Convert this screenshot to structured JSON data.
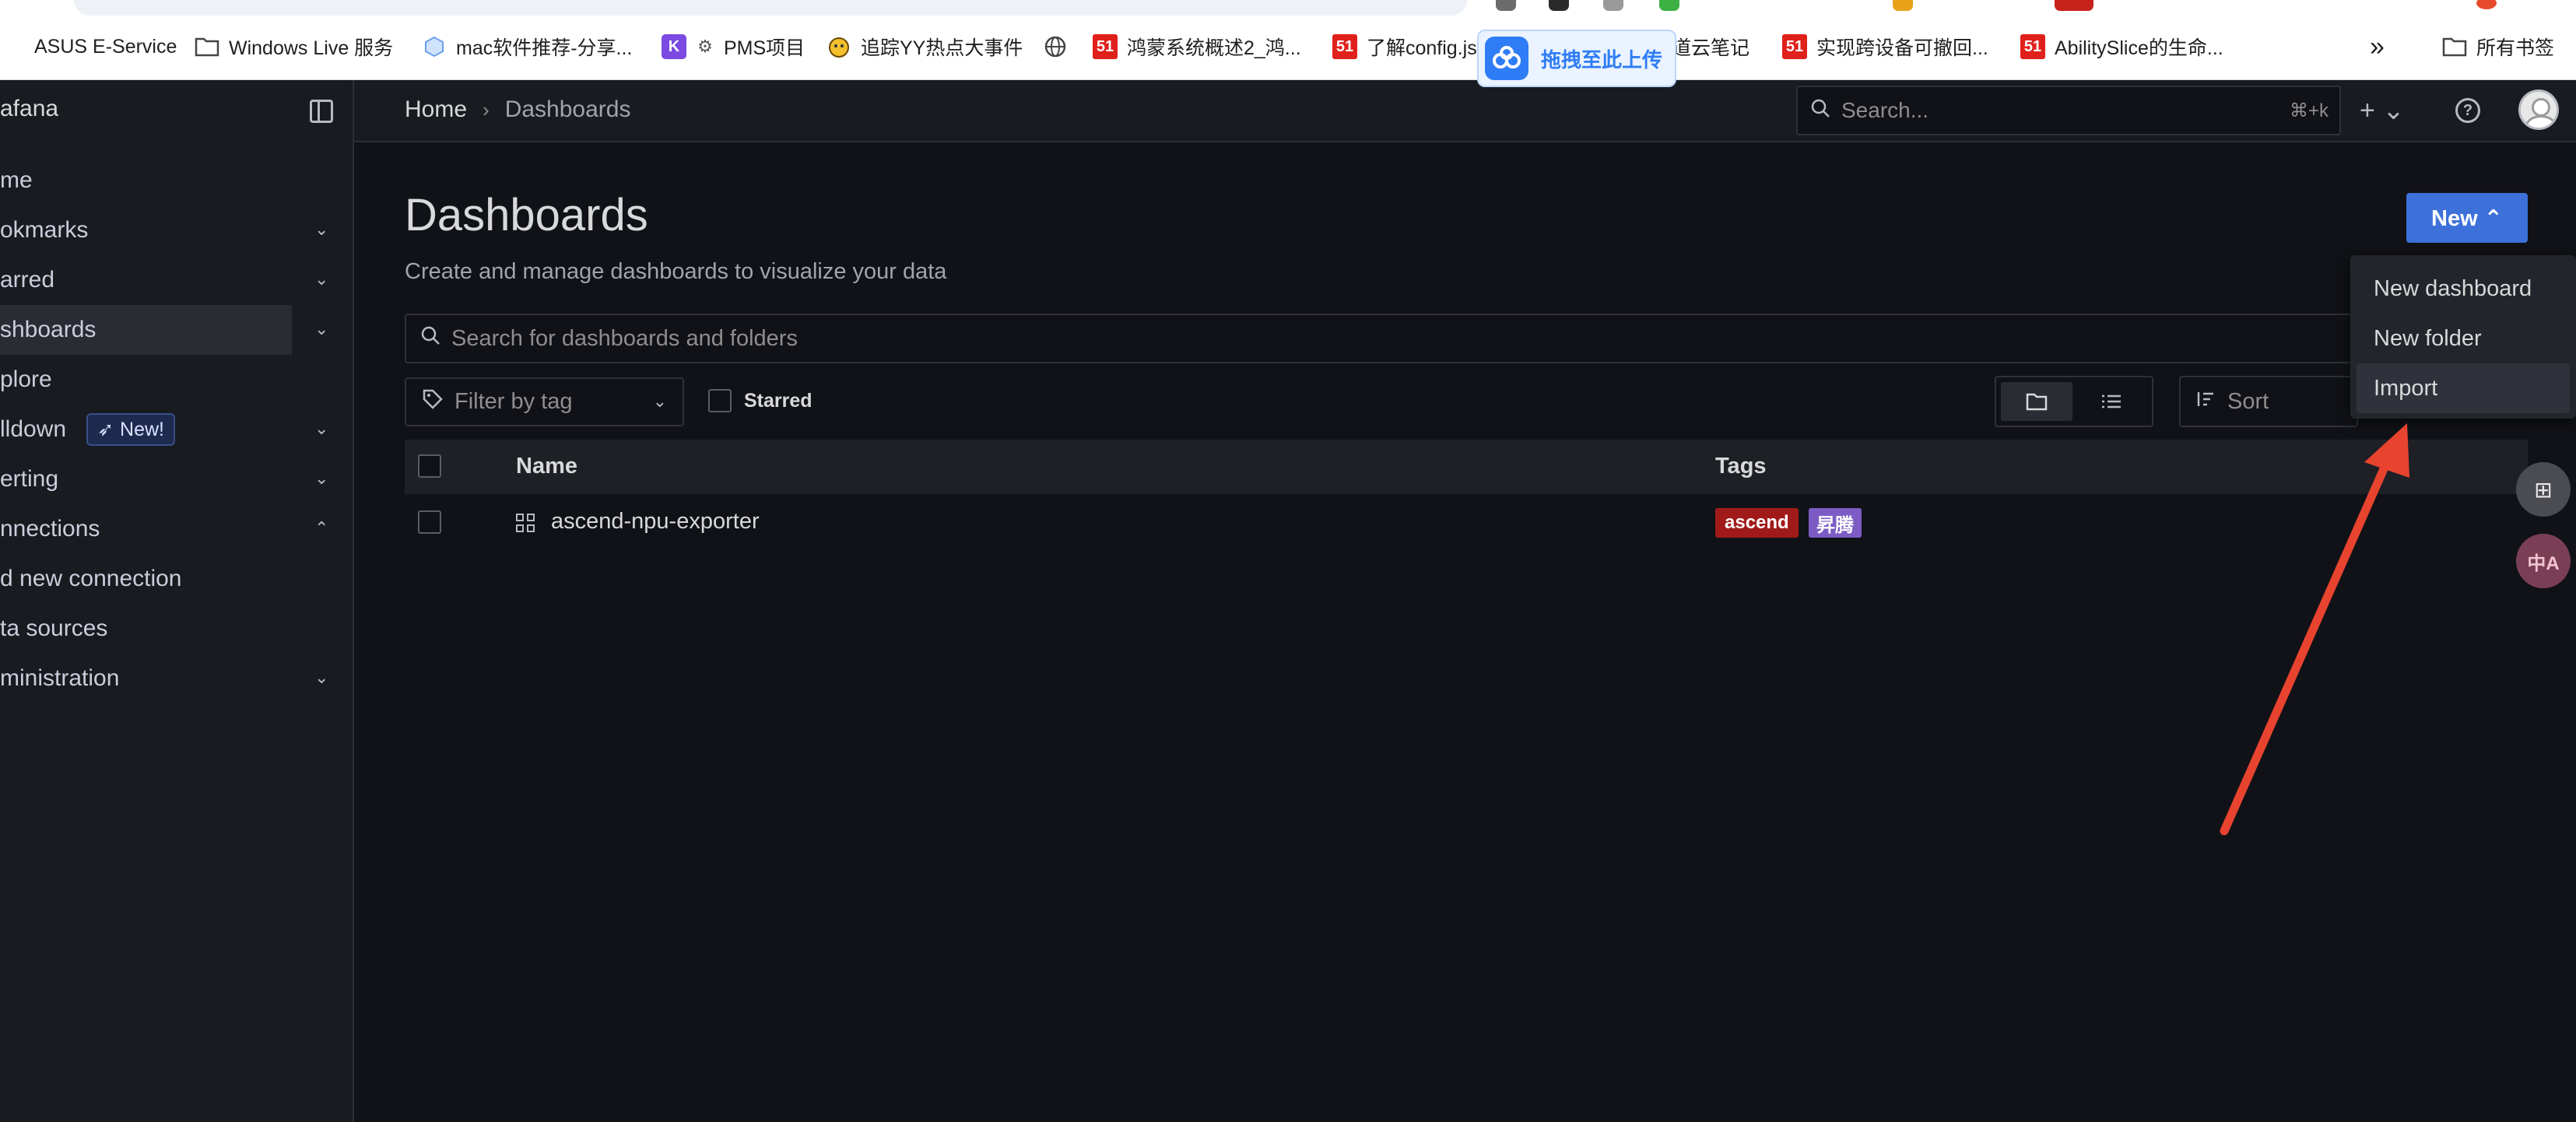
{
  "browser": {
    "bookmarks": [
      {
        "label": "ASUS E-Service",
        "icon": "asus-icon"
      },
      {
        "label": "Windows Live 服务",
        "icon": "folder-icon"
      },
      {
        "label": "mac软件推荐-分享...",
        "icon": "cube-icon"
      },
      {
        "label": "PMS项目",
        "icon": "k-icon"
      },
      {
        "label": "追踪YY热点大事件",
        "icon": "face-icon"
      },
      {
        "label": "",
        "icon": "globe-icon"
      },
      {
        "label": "鸿蒙系统概述2_鸿...",
        "icon": "51cto-icon"
      },
      {
        "label": "了解config.js",
        "icon": "51cto-icon"
      },
      {
        "label": "道云笔记",
        "icon": "note-icon"
      },
      {
        "label": "实现跨设备可撤回...",
        "icon": "51cto-icon"
      },
      {
        "label": "AbilitySlice的生命...",
        "icon": "51cto-icon"
      }
    ],
    "more_label": "»",
    "all_bookmarks_label": "所有书签",
    "upload_label": "拖拽至此上传",
    "icon_51": "51"
  },
  "app": {
    "brand": "afana",
    "search_placeholder": "Search...",
    "search_shortcut": "⌘+k",
    "plus_label": "+ ⌄"
  },
  "breadcrumb": {
    "home": "Home",
    "separator": "›",
    "current": "Dashboards"
  },
  "sidebar": {
    "items": [
      {
        "label": "me",
        "chevron": ""
      },
      {
        "label": "okmarks",
        "chevron": "⌄"
      },
      {
        "label": "arred",
        "chevron": "⌄"
      },
      {
        "label": "shboards",
        "chevron": "⌄"
      },
      {
        "label": "plore",
        "chevron": ""
      },
      {
        "label": "lldown",
        "chevron": "⌄",
        "badge": "New!"
      },
      {
        "label": "erting",
        "chevron": "⌄"
      },
      {
        "label": "nnections",
        "chevron": "⌃"
      },
      {
        "label": "d new connection",
        "chevron": ""
      },
      {
        "label": "ta sources",
        "chevron": ""
      },
      {
        "label": "ministration",
        "chevron": "⌄"
      }
    ]
  },
  "page": {
    "title": "Dashboards",
    "subtitle": "Create and manage dashboards to visualize your data",
    "new_button": "New ⌃",
    "search_placeholder": "Search for dashboards and folders",
    "filter_tag_placeholder": "Filter by tag",
    "starred_label": "Starred",
    "sort_label": "Sort"
  },
  "table": {
    "columns": {
      "name": "Name",
      "tags": "Tags"
    },
    "rows": [
      {
        "name": "ascend-npu-exporter",
        "tags": [
          {
            "label": "ascend",
            "color": "#a11a1a"
          },
          {
            "label": "昇腾",
            "color": "#7c5cc4"
          }
        ]
      }
    ]
  },
  "new_menu": {
    "items": [
      "New dashboard",
      "New folder",
      "Import"
    ],
    "highlighted": "Import"
  },
  "side_tools": {
    "translate_label": "中A",
    "apps_label": "⊞"
  },
  "colors": {
    "accent": "#3d71d9",
    "annotation_arrow": "#e8432f"
  }
}
